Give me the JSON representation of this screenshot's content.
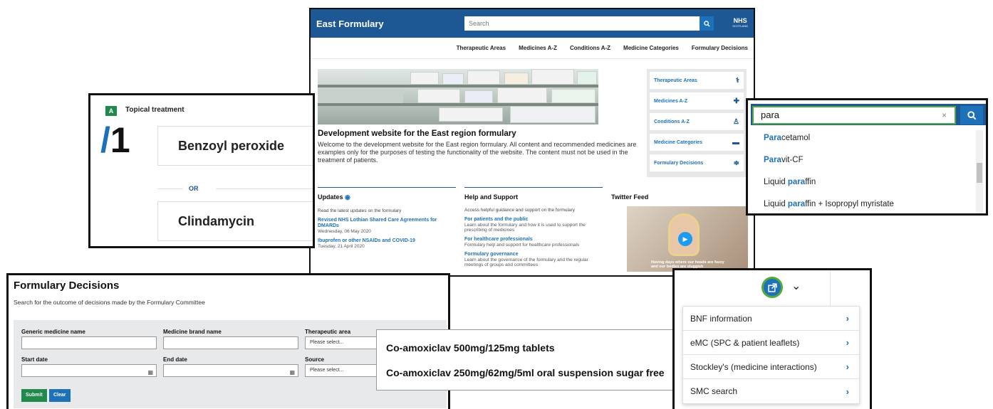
{
  "main": {
    "brand": "East Formulary",
    "search_placeholder": "Search",
    "nhs_logo": "NHS",
    "nhs_logo_sub": "SCOTLAND",
    "nav": [
      "Therapeutic Areas",
      "Medicines A-Z",
      "Conditions A-Z",
      "Medicine Categories",
      "Formulary Decisions"
    ],
    "heading": "Development website for the East region formulary",
    "intro": "Welcome to the development website for the East region formulary. All content and recommended medicines are examples only for the purposes of testing the functionality of the website. The content must not be used in the treatment of patients.",
    "side_menu": [
      {
        "label": "Therapeutic Areas",
        "icon": "stethoscope-icon",
        "glyph": "⚕"
      },
      {
        "label": "Medicines A-Z",
        "icon": "medicine-bag-icon",
        "glyph": "✚"
      },
      {
        "label": "Conditions A-Z",
        "icon": "person-icon",
        "glyph": "♙"
      },
      {
        "label": "Medicine Categories",
        "icon": "folder-icon",
        "glyph": "▬"
      },
      {
        "label": "Formulary Decisions",
        "icon": "signpost-icon",
        "glyph": "≑"
      }
    ],
    "updates": {
      "title": "Updates",
      "intro": "Read the latest updates on the formulary",
      "items": [
        {
          "title": "Revised NHS Lothian Shared Care Agreements for DMARDs",
          "date": "Wednesday, 06 May 2020"
        },
        {
          "title": "Ibuprofen or other NSAIDs and COVID-19",
          "date": "Tuesday, 21 April 2020"
        }
      ]
    },
    "help": {
      "title": "Help and Support",
      "intro": "Access helpful guidance and support on the formulary",
      "items": [
        {
          "title": "For patients and the public",
          "desc": "Learn about the formulary and how it is used to support the prescribing of medicines"
        },
        {
          "title": "For healthcare professionals",
          "desc": "Formulary help and support for healthcare professionals"
        },
        {
          "title": "Formulary governance",
          "desc": "Learn about the governance of the formulary and the regular meetings of groups and committees"
        }
      ]
    },
    "twitter": {
      "title": "Twitter Feed",
      "caption": "Having days where our heads are fuzzy and our bodies are sluggish"
    }
  },
  "topical": {
    "badge": "A",
    "title": "Topical treatment",
    "number": "1",
    "slash": "/",
    "drug1": "Benzoyl peroxide",
    "or": "OR",
    "drug2": "Clindamycin"
  },
  "decisions": {
    "title": "Formulary Decisions",
    "subtitle": "Search for the outcome of decisions made by the Formulary Committee",
    "labels": {
      "generic": "Generic medicine name",
      "brand": "Medicine brand name",
      "area": "Therapeutic area",
      "start": "Start date",
      "end": "End date",
      "source": "Source"
    },
    "select_placeholder": "Please select...",
    "submit": "Submit",
    "clear": "Clear"
  },
  "coamox": {
    "items": [
      "Co-amoxiclav 500mg/125mg tablets",
      "Co-amoxiclav 250mg/62mg/5ml oral suspension sugar free"
    ]
  },
  "search_dropdown": {
    "query": "para",
    "options": [
      {
        "pre": "",
        "match": "Para",
        "post": "cetamol"
      },
      {
        "pre": "",
        "match": "Para",
        "post": "vit-CF"
      },
      {
        "pre": "Liquid ",
        "match": "para",
        "post": "ffin"
      },
      {
        "pre": "Liquid ",
        "match": "para",
        "post": "ffin + Isopropyl myristate"
      }
    ]
  },
  "links_dropdown": {
    "items": [
      "BNF information",
      "eMC (SPC & patient leaflets)",
      "Stockley's (medicine interactions)",
      "SMC search"
    ]
  },
  "colors": {
    "nhs_blue": "#1d5794",
    "link_blue": "#1d71b8",
    "green": "#1f8a4c",
    "focus_green": "#53a83e"
  }
}
